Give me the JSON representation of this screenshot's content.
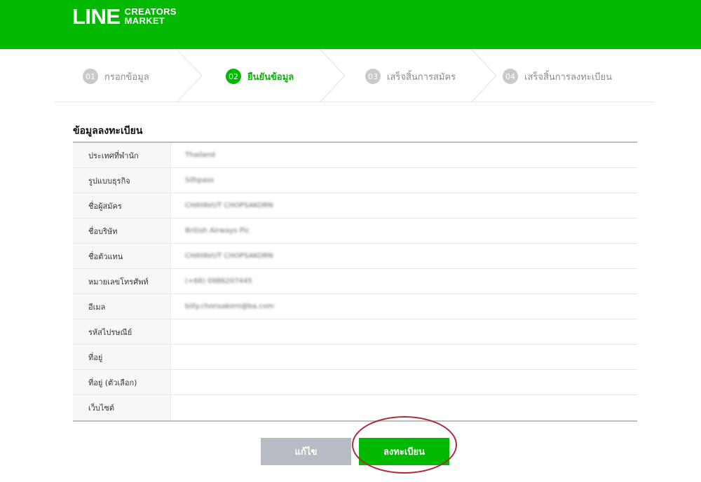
{
  "brand": {
    "logo_main": "LINE",
    "logo_sub_1": "CREATORS",
    "logo_sub_2": "MARKET",
    "accent_color": "#00b900"
  },
  "steps": [
    {
      "num": "01",
      "label": "กรอกข้อมูล",
      "active": false
    },
    {
      "num": "02",
      "label": "ยืนยันข้อมูล",
      "active": true
    },
    {
      "num": "03",
      "label": "เสร็จสิ้นการสมัคร",
      "active": false
    },
    {
      "num": "04",
      "label": "เสร็จสิ้นการลงทะเบียน",
      "active": false
    }
  ],
  "section_title": "ข้อมูลลงทะเบียน",
  "rows": [
    {
      "label": "ประเทศที่พำนัก",
      "value": "Thailand"
    },
    {
      "label": "รูปแบบธุรกิจ",
      "value": "Silhpass"
    },
    {
      "label": "ชื่อผู้สมัคร",
      "value": "CHAYAVUT CHOPSAKORN"
    },
    {
      "label": "ชื่อบริษัท",
      "value": "British Airways Plc"
    },
    {
      "label": "ชื่อตัวแทน",
      "value": "CHAYAVUT CHOPSAKORN"
    },
    {
      "label": "หมายเลขโทรศัพท์",
      "value": "(+66) 0986207445"
    },
    {
      "label": "อีเมล",
      "value": "billy.chonsakorn@ba.com"
    },
    {
      "label": "รหัสไปรษณีย์",
      "value": ""
    },
    {
      "label": "ที่อยู่",
      "value": ""
    },
    {
      "label": "ที่อยู่ (ตัวเลือก)",
      "value": ""
    },
    {
      "label": "เว็บไซต์",
      "value": ""
    }
  ],
  "buttons": {
    "edit_label": "แก้ไข",
    "register_label": "ลงทะเบียน"
  },
  "annotation_color": "#b0283a"
}
